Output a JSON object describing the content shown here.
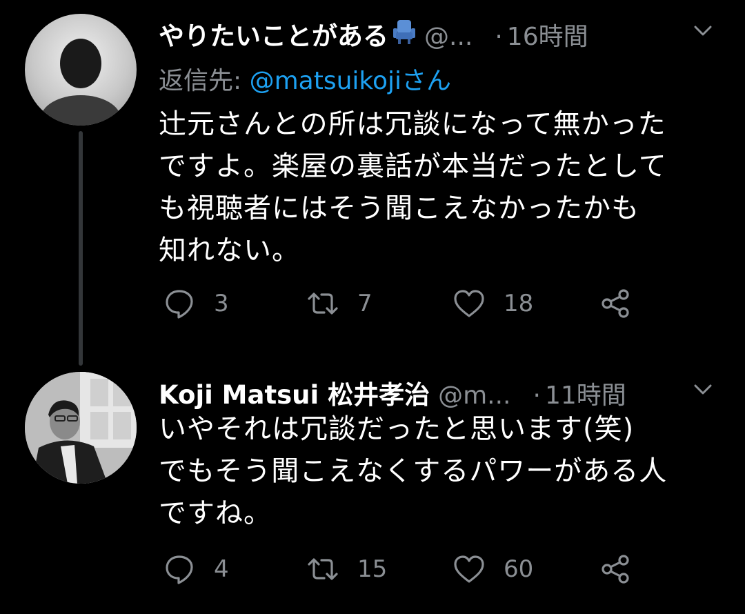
{
  "tweets": [
    {
      "display_name": "やりたいことがある",
      "name_icon": "seat-icon",
      "handle": "@...",
      "dot": "·",
      "time": "16時間",
      "reply_prefix": "返信先: ",
      "reply_mention": "@matsuikoji",
      "reply_suffix": "さん",
      "text": "辻元さんとの所は冗談になって無かった\nですよ。楽屋の裏話が本当だったとして\nも視聴者にはそう聞こえなかったかも\n知れない。",
      "counts": {
        "reply": "3",
        "retweet": "7",
        "like": "18"
      }
    },
    {
      "display_name": "Koji Matsui 松井孝治",
      "handle": "@m...",
      "dot": "·",
      "time": "11時間",
      "text": "いやそれは冗談だったと思います(笑)\nでもそう聞こえなくするパワーがある人\nですね。",
      "counts": {
        "reply": "4",
        "retweet": "15",
        "like": "60"
      }
    }
  ],
  "colors": {
    "background": "#000000",
    "text": "#ffffff",
    "secondary": "#8b8f94",
    "link": "#1da1f2",
    "seat_icon": "#5b8fd6"
  },
  "icons": [
    "reply-icon",
    "retweet-icon",
    "like-icon",
    "share-icon",
    "chevron-down-icon",
    "seat-icon"
  ]
}
